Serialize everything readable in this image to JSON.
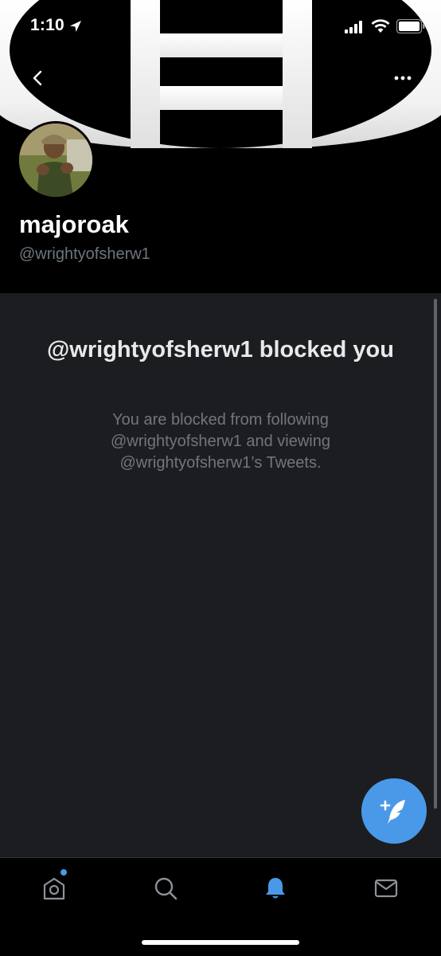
{
  "status_bar": {
    "time": "1:10"
  },
  "profile": {
    "display_name": "majoroak",
    "handle": "@wrightyofsherw1"
  },
  "blocked": {
    "title": "@wrightyofsherw1 blocked you",
    "description": "You are blocked from following @wrightyofsherw1 and viewing @wrightyofsherw1’s Tweets."
  },
  "header": {
    "back_icon": "chevron-left-icon",
    "more_icon": "more-dots-icon"
  },
  "fab": {
    "icon": "compose-tweet-icon"
  },
  "tabbar": {
    "tabs": [
      {
        "name": "home",
        "icon": "home-icon",
        "has_badge": true
      },
      {
        "name": "search",
        "icon": "search-icon"
      },
      {
        "name": "notifications",
        "icon": "bell-icon",
        "active": true
      },
      {
        "name": "messages",
        "icon": "mail-icon"
      }
    ]
  },
  "colors": {
    "accent": "#4a99e9",
    "panel_bg": "#1c1d21",
    "muted_text": "#71767b"
  }
}
